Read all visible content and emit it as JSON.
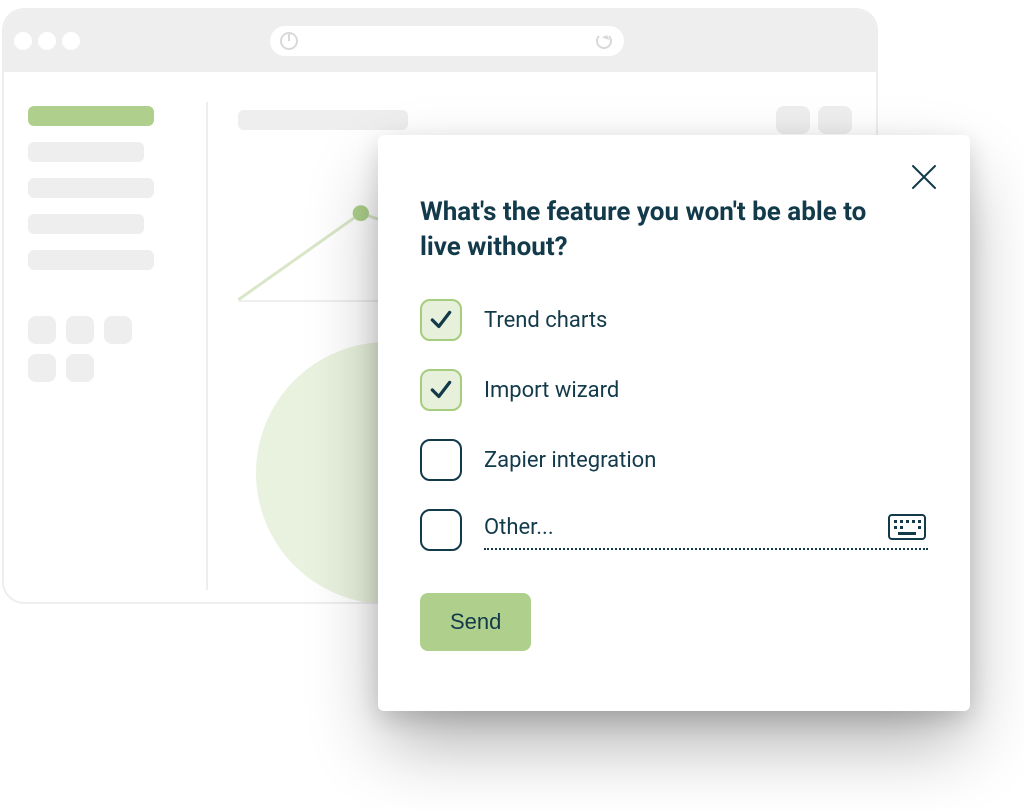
{
  "survey": {
    "question": "What's the feature you won't be able to live without?",
    "options": [
      {
        "label": "Trend charts",
        "checked": true
      },
      {
        "label": "Import wizard",
        "checked": true
      },
      {
        "label": "Zapier integration",
        "checked": false
      }
    ],
    "other_label": "Other...",
    "other_checked": false,
    "send_label": "Send"
  }
}
